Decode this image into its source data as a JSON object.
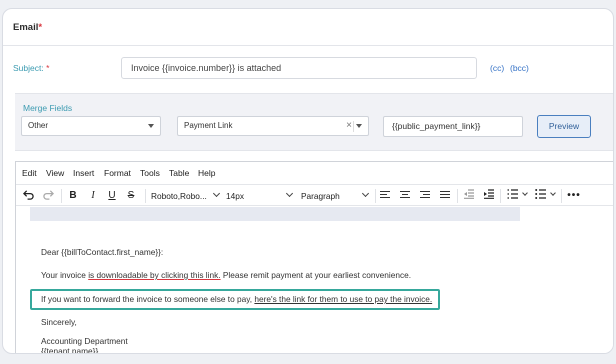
{
  "email": {
    "section_title": "Email",
    "required_mark": "*",
    "subject_label": "Subject:",
    "subject_value": "Invoice {{invoice.number}} is attached",
    "cc": "(cc)",
    "bcc": "(bcc)"
  },
  "merge": {
    "label": "Merge Fields",
    "category_selected": "Other",
    "field_selected": "Payment Link",
    "clear_glyph": "×",
    "token": "{{public_payment_link}}",
    "preview_label": "Preview"
  },
  "editor": {
    "menu": [
      "Edit",
      "View",
      "Insert",
      "Format",
      "Tools",
      "Table",
      "Help"
    ],
    "font_family": "Roboto,Robo...",
    "font_size": "14px",
    "block_format": "Paragraph",
    "body": {
      "greeting": "Dear {{billToContact.first_name}}:",
      "line1_a": "Your invoice ",
      "line1_b": "is downloadable by clicking this link.",
      "line1_c": " Please remit payment at your earliest convenience.",
      "line2_a": "If you want to forward the invoice to someone else to pay, ",
      "line2_b": "here's the link for them to use to pay the invoice.",
      "closing": "Sincerely,",
      "signature_1": "Accounting Department",
      "signature_2": "{{tenant.name}}"
    }
  },
  "colors": {
    "label_teal": "#3c9bb1",
    "link_blue": "#3572c6",
    "required_red": "#d9363e",
    "highlight_teal": "#36a89c",
    "preview_border": "#4a7fbf"
  },
  "icons": [
    "undo-icon",
    "redo-icon",
    "bold-icon",
    "italic-icon",
    "underline-icon",
    "strikethrough-icon",
    "align-left-icon",
    "align-center-icon",
    "align-right-icon",
    "align-justify-icon",
    "outdent-icon",
    "indent-icon",
    "numbered-list-icon",
    "bullet-list-icon",
    "more-icon"
  ]
}
